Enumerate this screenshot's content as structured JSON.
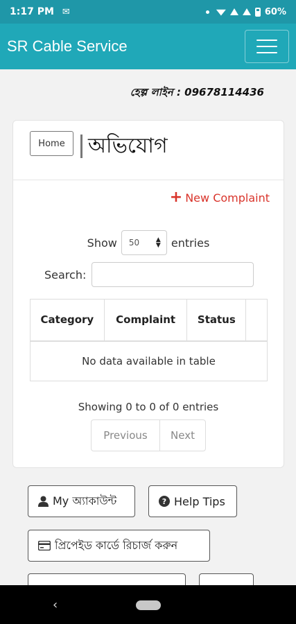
{
  "status_bar": {
    "time": "1:17 PM",
    "battery": "60%"
  },
  "app_bar": {
    "title": "SR Cable Service"
  },
  "helpline": "হেল্প লাইন : 09678114436",
  "card": {
    "home_label": "Home",
    "heading": "অভিযোগ",
    "new_complaint_label": "New Complaint"
  },
  "table_controls": {
    "show_label": "Show",
    "entries_value": "50",
    "entries_label": "entries",
    "search_label": "Search:",
    "search_value": ""
  },
  "table": {
    "columns": [
      "Category",
      "Complaint",
      "Status",
      ""
    ],
    "empty_message": "No data available in table"
  },
  "pagination": {
    "info": "Showing 0 to 0 of 0 entries",
    "previous": "Previous",
    "next": "Next"
  },
  "bottom_buttons": {
    "my_account": "My অ্যাকাউন্ট",
    "help_tips": "Help Tips",
    "prepaid_recharge": "প্রিপেইড কার্ডে রিচার্জ করুন"
  },
  "colors": {
    "primary": "#20a8b8",
    "status_bar": "#1f97a8",
    "accent_red": "#d9342b"
  },
  "icons": [
    "mail-icon",
    "wifi-icon",
    "signal-icon",
    "battery-icon",
    "hamburger-menu-icon",
    "plus-icon",
    "sort-arrows-icon",
    "user-icon",
    "question-circle-icon",
    "credit-card-icon",
    "back-icon",
    "home-pill-icon"
  ]
}
